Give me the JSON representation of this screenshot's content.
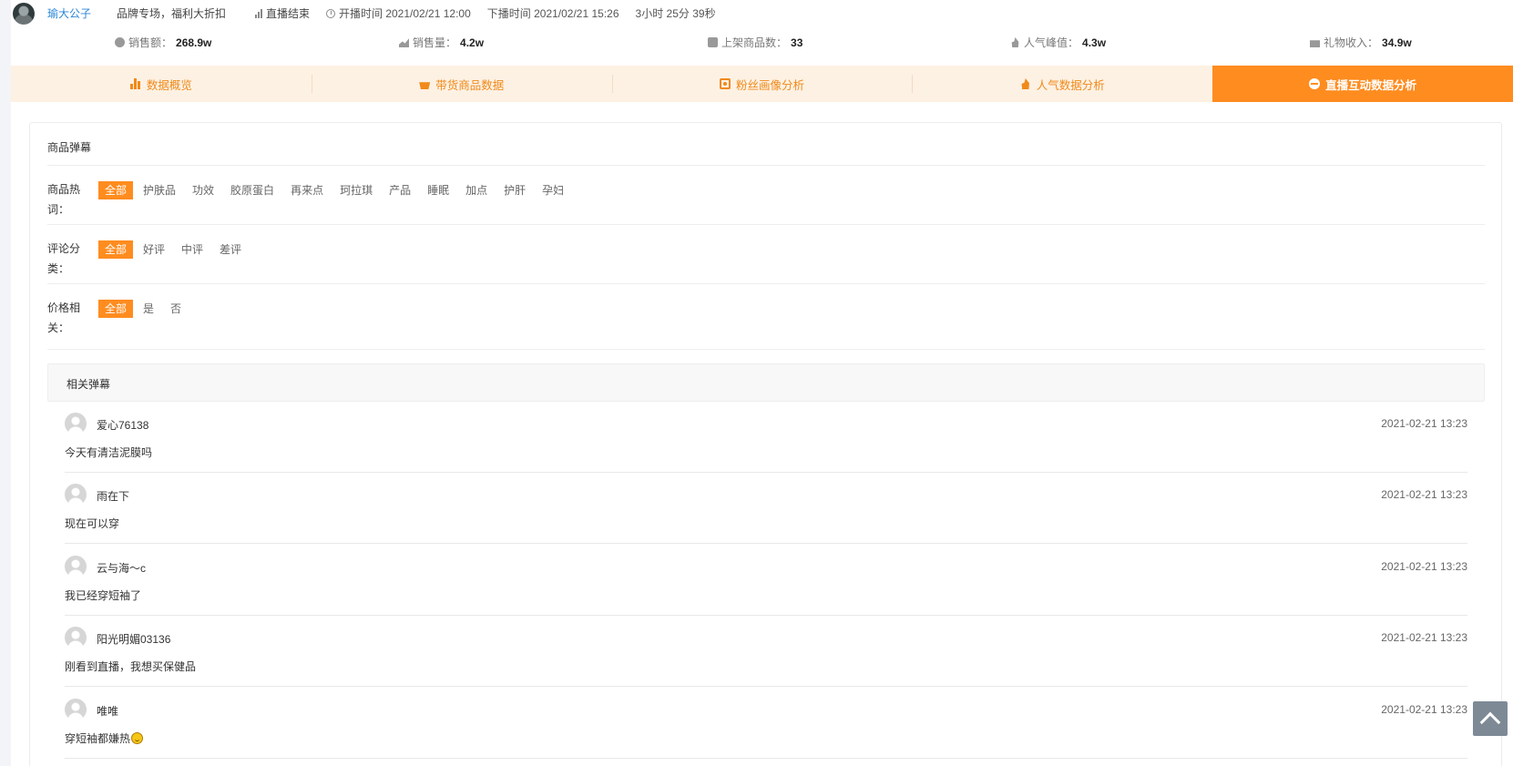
{
  "header": {
    "streamer_name": "瑜大公子",
    "stream_title": "品牌专场，福利大折扣",
    "status": "直播结束",
    "start_time": "开播时间 2021/02/21 12:00",
    "end_time": "下播时间 2021/02/21 15:26",
    "duration": "3小时 25分 39秒"
  },
  "stats": [
    {
      "label": "销售额：",
      "value": "268.9w",
      "icon": "coin-icon"
    },
    {
      "label": "销售量：",
      "value": "4.2w",
      "icon": "chart-icon"
    },
    {
      "label": "上架商品数：",
      "value": "33",
      "icon": "bag-icon"
    },
    {
      "label": "人气峰值：",
      "value": "4.3w",
      "icon": "flame-icon"
    },
    {
      "label": "礼物收入：",
      "value": "34.9w",
      "icon": "gift-icon"
    }
  ],
  "tabs": [
    {
      "label": "数据概览",
      "icon": "bar-chart-icon",
      "active": false
    },
    {
      "label": "带货商品数据",
      "icon": "basket-icon",
      "active": false
    },
    {
      "label": "粉丝画像分析",
      "icon": "scan-face-icon",
      "active": false
    },
    {
      "label": "人气数据分析",
      "icon": "fire-icon",
      "active": false
    },
    {
      "label": "直播互动数据分析",
      "icon": "pulse-icon",
      "active": true
    }
  ],
  "panel": {
    "title": "商品弹幕",
    "filters": [
      {
        "label_line1": "商品热",
        "label_line2": "词：",
        "options": [
          "全部",
          "护肤品",
          "功效",
          "胶原蛋白",
          "再来点",
          "珂拉琪",
          "产品",
          "睡眠",
          "加点",
          "护肝",
          "孕妇"
        ],
        "selected": "全部"
      },
      {
        "label_line1": "评论分",
        "label_line2": "类：",
        "options": [
          "全部",
          "好评",
          "中评",
          "差评"
        ],
        "selected": "全部"
      },
      {
        "label_line1": "价格相",
        "label_line2": "关：",
        "options": [
          "全部",
          "是",
          "否"
        ],
        "selected": "全部"
      }
    ],
    "section_title": "相关弹幕",
    "comments": [
      {
        "user": "爱心76138",
        "time": "2021-02-21 13:23",
        "text": "今天有清洁泥膜吗"
      },
      {
        "user": "雨在下",
        "time": "2021-02-21 13:23",
        "text": "现在可以穿"
      },
      {
        "user": "云与海～c",
        "time": "2021-02-21 13:23",
        "text": "我已经穿短袖了"
      },
      {
        "user": "阳光明媚03136",
        "time": "2021-02-21 13:23",
        "text": "刚看到直播，我想买保健品"
      },
      {
        "user": "唯唯",
        "time": "2021-02-21 13:23",
        "text": "穿短袖都嫌热",
        "emoji": "grin-sweat-emoji"
      }
    ]
  },
  "colors": {
    "accent": "#ff8c1f",
    "tab_bg": "#fdf1e3",
    "link": "#2a86d8"
  }
}
